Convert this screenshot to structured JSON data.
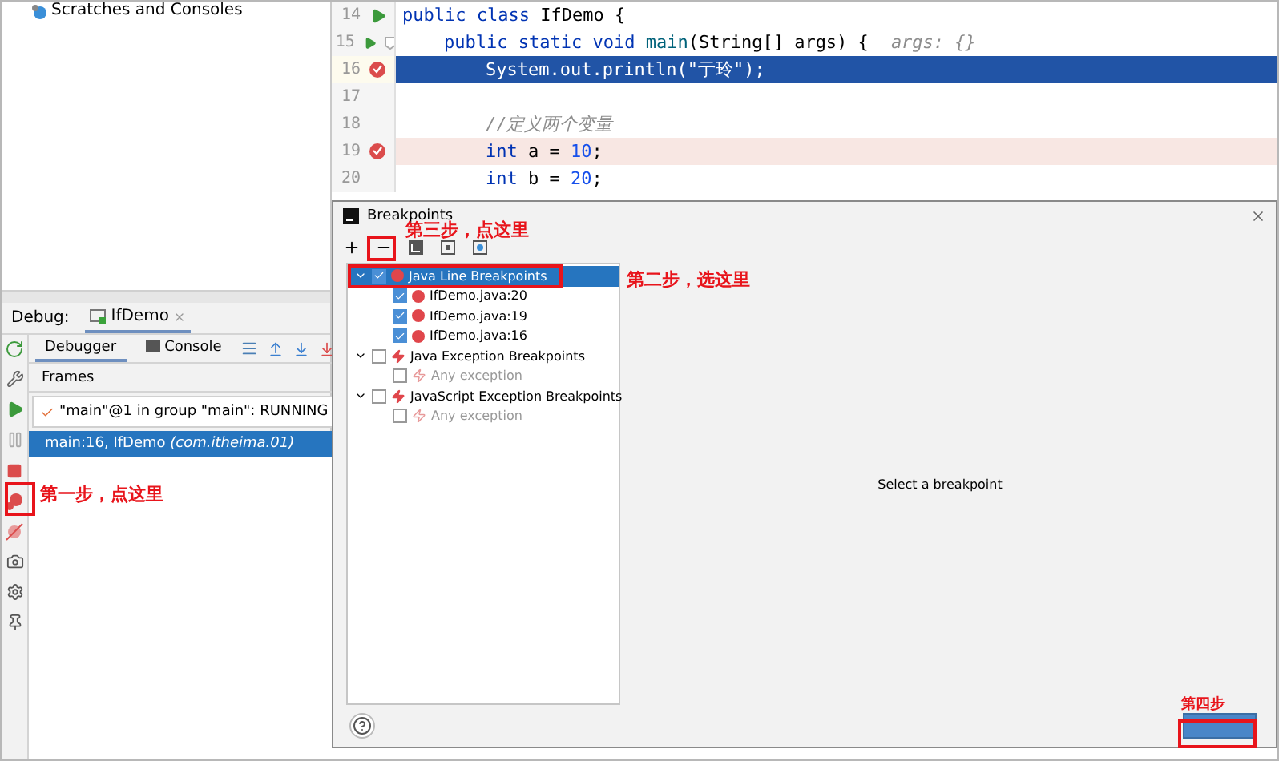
{
  "project": {
    "item": "Scratches and Consoles"
  },
  "editor": {
    "lines": [
      {
        "number": "14",
        "run": true,
        "breakpoint": false,
        "current": false,
        "fold": false,
        "tokens": [
          {
            "kind": "keyword",
            "text": "public class "
          },
          {
            "kind": "plain",
            "text": "IfDemo {"
          }
        ],
        "children": [
          {
            "number": "15",
            "run": true,
            "breakpoint": false,
            "current": false,
            "fold": true,
            "tokens": [
              {
                "kind": "keyword",
                "text": "public static void "
              },
              {
                "kind": "method",
                "text": "main"
              },
              {
                "kind": "plain",
                "text": "(String[] args) {"
              },
              {
                "kind": "hint",
                "text": "args: {}"
              }
            ],
            "children": [
              {
                "number": "16",
                "run": false,
                "breakpoint": true,
                "current": true,
                "fold": false,
                "tokens": [
                  {
                    "kind": "plain",
                    "text": "System.out.println(\"亍玲\");"
                  }
                ]
              },
              {
                "number": "17",
                "run": false,
                "breakpoint": false,
                "current": false,
                "fold": false
              },
              {
                "number": "18",
                "run": false,
                "breakpoint": false,
                "current": false,
                "fold": false,
                "tokens": [
                  {
                    "kind": "comment",
                    "text": "//定义两个变量"
                  }
                ]
              },
              {
                "number": "19",
                "run": false,
                "breakpoint": true,
                "current": false,
                "fold": false,
                "tokens": [
                  {
                    "kind": "keyword",
                    "text": "int "
                  },
                  {
                    "kind": "plain",
                    "text": "a = "
                  },
                  {
                    "kind": "number",
                    "text": "10"
                  },
                  {
                    "kind": "plain",
                    "text": ";"
                  }
                ]
              },
              {
                "number": "20",
                "run": false,
                "breakpoint": false,
                "current": false,
                "fold": false,
                "tokens": [
                  {
                    "kind": "keyword",
                    "text": "int "
                  },
                  {
                    "kind": "plain",
                    "text": "b = "
                  },
                  {
                    "kind": "number",
                    "text": "20"
                  },
                  {
                    "kind": "plain",
                    "text": ";"
                  }
                ]
              }
            ]
          }
        ]
      }
    ]
  },
  "debug": {
    "label": "Debug:",
    "session": "IfDemo",
    "tabs": [
      {
        "label": "Debugger",
        "selected": true
      },
      {
        "label": "Console",
        "selected": false
      }
    ],
    "frames_title": "Frames",
    "thread": "\"main\"@1 in group \"main\": RUNNING",
    "frames": [
      {
        "text": "main:16, IfDemo *(com.itheima.01)*",
        "selected": true
      }
    ]
  },
  "dialog": {
    "title": "Breakpoints",
    "tree": [
      {
        "label": "Java Line Breakpoints",
        "kind": "line",
        "checked": true,
        "selected": true,
        "expanded": true,
        "children": [
          {
            "label": "IfDemo.java:20",
            "kind": "line",
            "checked": true,
            "disabled": false
          },
          {
            "label": "IfDemo.java:19",
            "kind": "line",
            "checked": true,
            "disabled": false
          },
          {
            "label": "IfDemo.java:16",
            "kind": "line",
            "checked": true,
            "disabled": false
          }
        ]
      },
      {
        "label": "Java Exception Breakpoints",
        "kind": "exception",
        "checked": false,
        "selected": false,
        "expanded": true,
        "children": [
          {
            "label": "Any exception",
            "kind": "exception",
            "checked": false,
            "disabled": true
          }
        ]
      },
      {
        "label": "JavaScript Exception Breakpoints",
        "kind": "exception",
        "checked": false,
        "selected": false,
        "expanded": true,
        "children": [
          {
            "label": "Any exception",
            "kind": "exception",
            "checked": false,
            "disabled": true
          }
        ]
      }
    ],
    "detail": "Select a breakpoint"
  },
  "annotations": [
    {
      "kind": "debug-tool",
      "text": "第一步，点这里"
    },
    {
      "kind": "tree",
      "text": "第二步，选这里"
    },
    {
      "kind": "toolbar",
      "text": "第三步，点这里"
    },
    {
      "kind": "footer",
      "text": "第四步"
    }
  ]
}
